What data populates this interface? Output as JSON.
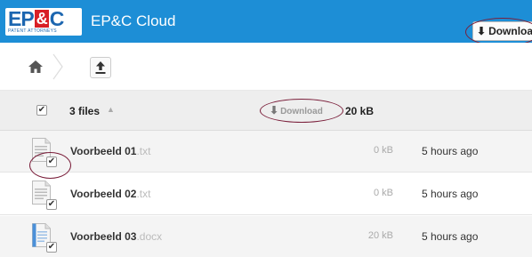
{
  "header": {
    "logo_text": "EP&C",
    "logo_sub": "PATENT ATTORNEYS",
    "title": "EP&C Cloud",
    "download_button": "Download",
    "bg_color": "#1d8ed6"
  },
  "breadcrumb": {
    "home_icon": "home-icon",
    "upload_icon": "upload-icon"
  },
  "table_header": {
    "selected_count": "3 files",
    "sort_icon": "▲",
    "download_label": "Download",
    "total_size": "20 kB"
  },
  "files": [
    {
      "name": "Voorbeeld 01",
      "ext": ".txt",
      "size": "0 kB",
      "modified": "5 hours ago",
      "icon": "text-file-icon"
    },
    {
      "name": "Voorbeeld 02",
      "ext": ".txt",
      "size": "0 kB",
      "modified": "5 hours ago",
      "icon": "text-file-icon"
    },
    {
      "name": "Voorbeeld 03",
      "ext": ".docx",
      "size": "20 kB",
      "modified": "5 hours ago",
      "icon": "docx-file-icon"
    }
  ],
  "colors": {
    "accent": "#1d8ed6",
    "highlight_ring": "#7a1e3a",
    "logo_red": "#d81f26",
    "logo_blue": "#1c66b0"
  }
}
